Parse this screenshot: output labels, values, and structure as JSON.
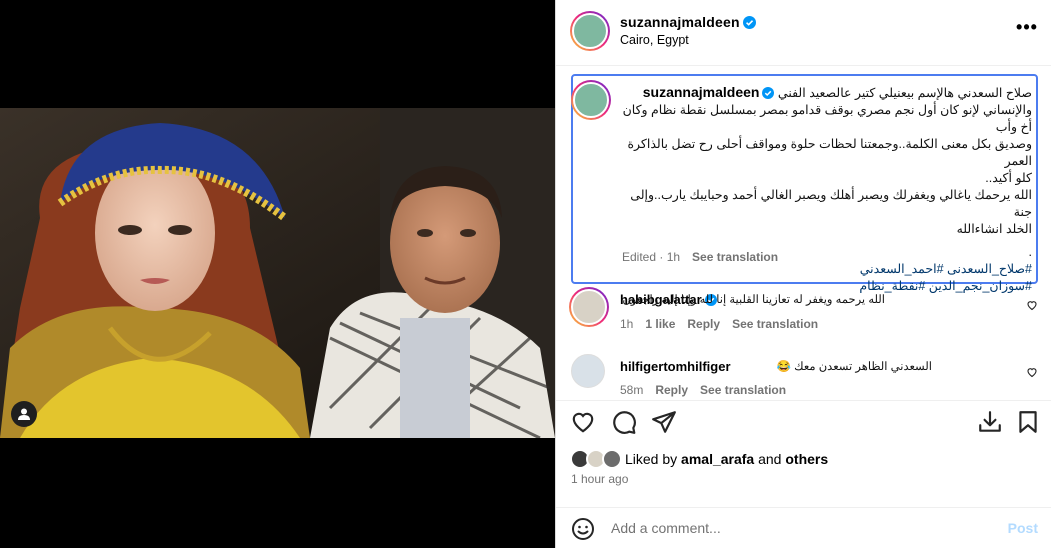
{
  "post": {
    "username": "suzannajmaldeen",
    "location": "Cairo, Egypt",
    "more_label": "•••"
  },
  "caption": {
    "username": "suzannajmaldeen",
    "line1": "صلاح السعدني هالإسم بيعنيلي كتير عالصعيد الفني",
    "line2": "والإنساني لإنو كان أول نجم مصري بوقف قدامو بمصر بمسلسل نقطة نظام وكان أخ وأب",
    "line3": "وصديق بكل معنى الكلمة..وجمعتنا لحظات حلوة ومواقف أحلى رح تضل بالذاكرة العمر",
    "line4": "كلو أكيد..",
    "line5": "الله يرحمك ياغالي ويغفرلك ويصبر أهلك ويصبر الغالي أحمد وحبايبك يارب..وإلى جنة",
    "line6": "الخلد انشاءالله",
    "line7": ".",
    "tags1": "#صلاح_السعدنى #احمد_السعدني",
    "tags2": "#سوزان_نجم_الدين #نقطة_نظام",
    "edited": "Edited · 1h",
    "see_translation": "See translation"
  },
  "comments": [
    {
      "username": "habibgalattar",
      "text": "الله يرحمه ويغفر له تعازينا القلبية إنا لله وإنا إليه راجعون",
      "time": "1h",
      "likes": "1 like",
      "reply": "Reply",
      "see_translation": "See translation"
    },
    {
      "username": "hilfigertomhilfiger",
      "text": "السعدني الظاهر تسعدن معك 😂",
      "time": "58m",
      "reply": "Reply",
      "see_translation": "See translation"
    }
  ],
  "likes": {
    "prefix": "Liked by",
    "user": "amal_arafa",
    "and": "and",
    "others": "others"
  },
  "time_ago": "1 hour ago",
  "add_comment": {
    "placeholder": "Add a comment...",
    "post_label": "Post"
  },
  "colors": {
    "accent": "#0095f6",
    "verified": "#0095f6",
    "highlight_border": "#4c7cf0",
    "hashtag": "#00376b"
  }
}
